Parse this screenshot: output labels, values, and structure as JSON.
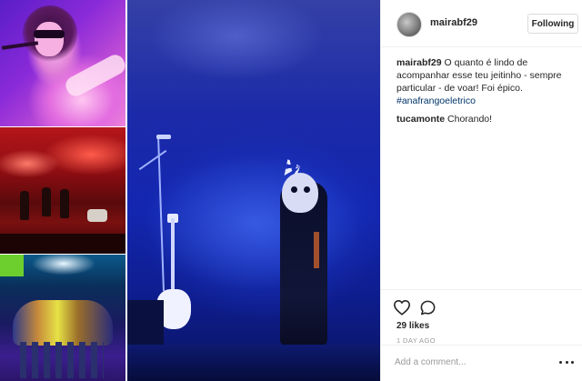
{
  "post": {
    "username": "mairabf29",
    "follow_button": "Following",
    "comments": [
      {
        "user": "mairabf29",
        "text": "O quanto é lindo de acompanhar esse teu jeitinho - sempre particular - de voar! Foi épico.",
        "hashtag": "#anafrangoeletrico"
      },
      {
        "user": "tucamonte",
        "text": "Chorando!"
      }
    ],
    "likes": "29 likes",
    "time_ago": "1 DAY AGO",
    "add_comment_placeholder": "Add a comment..."
  },
  "icons": {
    "like": "heart-icon",
    "comment": "speech-bubble-icon",
    "more": "more-options-icon"
  },
  "colors": {
    "text": "#262626",
    "muted": "#999999",
    "hashtag": "#003569",
    "border": "#efefef"
  }
}
